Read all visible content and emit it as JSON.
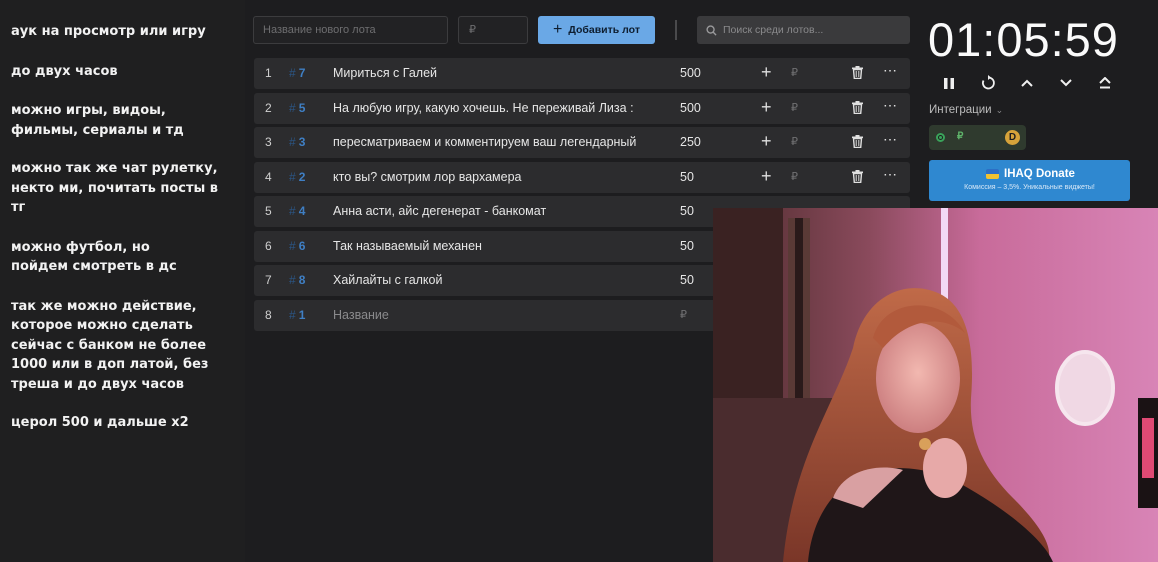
{
  "notes": [
    "аук на просмотр или игру",
    "до  двух часов",
    "можно игры, видоы, фильмы, сериалы и тд",
    "можно так же чат рулетку, некто ми, почитать посты в тг",
    "можно футбол, но пойдем смотреть в дс",
    "так же можно действие, которое можно сделать сейчас с банком не более 1000 или в доп латой, без треша  и до двух часов",
    "церол 500 и дальше х2"
  ],
  "toolbar": {
    "lot_name_placeholder": "Название нового лота",
    "amount_placeholder": "₽",
    "add_lot_label": "Добавить лот",
    "search_placeholder": "Поиск среди лотов..."
  },
  "lots": [
    {
      "index": "1",
      "id": "7",
      "title": "Мириться с Галей",
      "amount": "500"
    },
    {
      "index": "2",
      "id": "5",
      "title": "На любую игру, какую хочешь. Не переживай Лиза :",
      "amount": "500"
    },
    {
      "index": "3",
      "id": "3",
      "title": "пересматриваем и комментируем ваш легендарный",
      "amount": "250"
    },
    {
      "index": "4",
      "id": "2",
      "title": "кто вы? смотрим лор вархамера",
      "amount": "50"
    },
    {
      "index": "5",
      "id": "4",
      "title": "Анна асти, айс дегенерат - банкомат",
      "amount": "50"
    },
    {
      "index": "6",
      "id": "6",
      "title": "Так называемый механен",
      "amount": "50"
    },
    {
      "index": "7",
      "id": "8",
      "title": "Хайлайты с галкой",
      "amount": "50"
    },
    {
      "index": "8",
      "id": "1",
      "title": "Название",
      "amount": ""
    }
  ],
  "currency_symbol": "₽",
  "timer": "01:05:59",
  "integrations_label": "Интеграции",
  "integration": {
    "currency": "₽",
    "logo_letter": "D"
  },
  "donate": {
    "title": "IHAQ Donate",
    "subtitle": "Комиссия – 3,5%. Уникальные виджеты!"
  },
  "colors": {
    "accent": "#6aa8e6",
    "lot_id": "#3f7fc4",
    "donate": "#2f88d0",
    "integration_on": "#3aa35a"
  }
}
